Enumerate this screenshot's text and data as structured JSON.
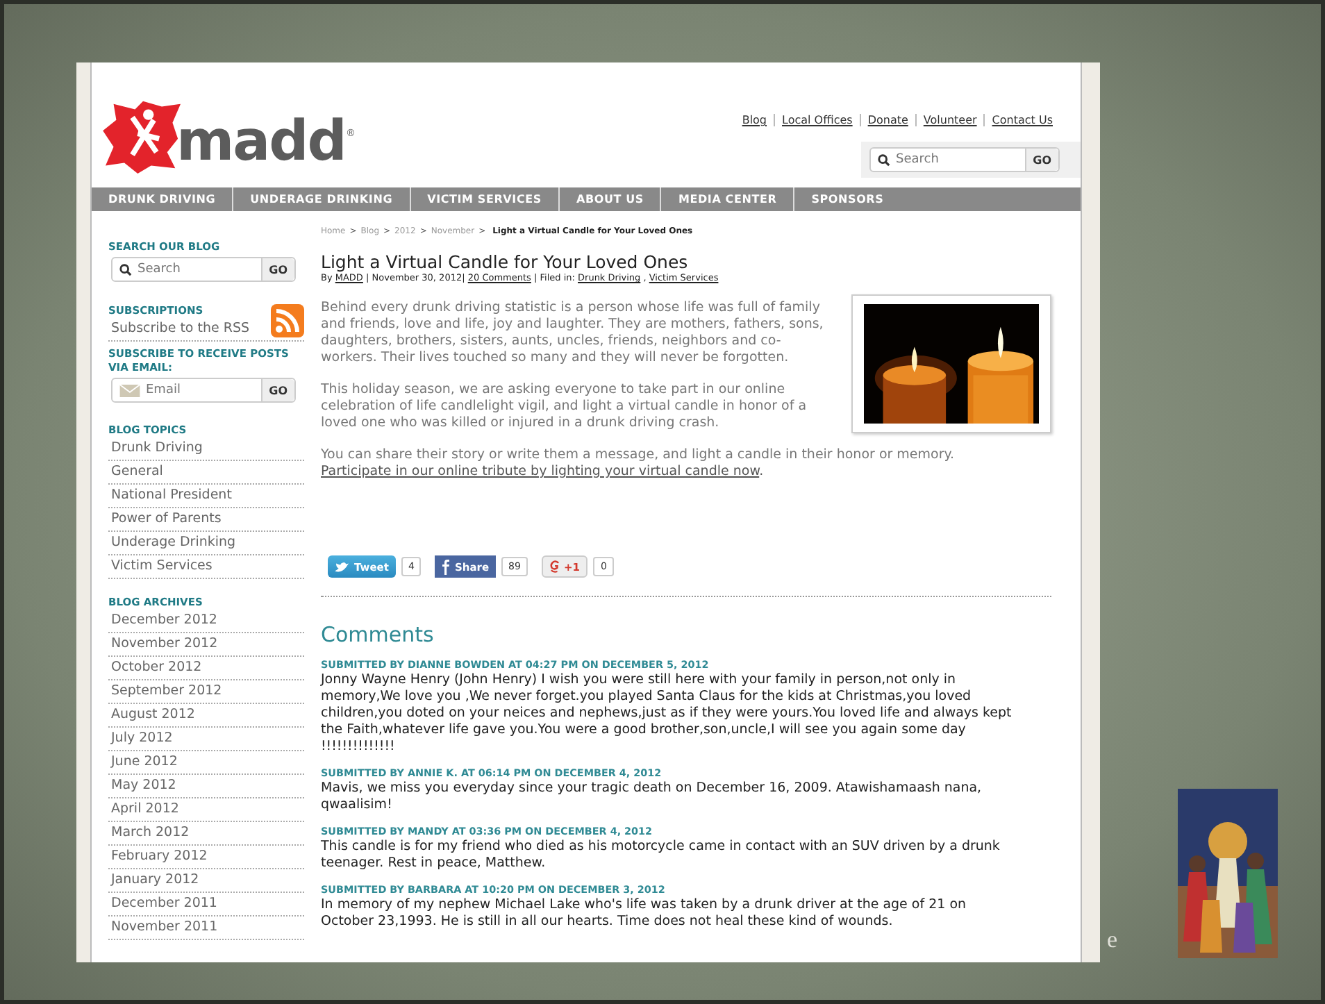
{
  "page": {
    "header": {
      "logo_text": "madd",
      "logo_mark": "®",
      "top_links": [
        "Blog",
        "Local Offices",
        "Donate",
        "Volunteer",
        "Contact Us"
      ],
      "search": {
        "placeholder": "Search",
        "button": "GO"
      }
    },
    "nav": [
      "DRUNK DRIVING",
      "UNDERAGE DRINKING",
      "VICTIM SERVICES",
      "ABOUT US",
      "MEDIA CENTER",
      "SPONSORS"
    ],
    "sidebar": {
      "search": {
        "heading": "SEARCH OUR BLOG",
        "placeholder": "Search",
        "button": "GO"
      },
      "subscriptions": {
        "heading": "SUBSCRIPTIONS",
        "link": "Subscribe to the RSS"
      },
      "email": {
        "heading": "SUBSCRIBE TO RECEIVE POSTS VIA EMAIL:",
        "placeholder": "Email",
        "button": "GO"
      },
      "topics": {
        "heading": "BLOG TOPICS",
        "items": [
          "Drunk Driving",
          "General",
          "National President",
          "Power of Parents",
          "Underage Drinking",
          "Victim Services"
        ]
      },
      "archives": {
        "heading": "BLOG ARCHIVES",
        "items": [
          "December 2012",
          "November 2012",
          "October 2012",
          "September 2012",
          "August 2012",
          "July 2012",
          "June 2012",
          "May 2012",
          "April 2012",
          "March 2012",
          "February 2012",
          "January 2012",
          "December 2011",
          "November 2011"
        ]
      }
    },
    "article": {
      "breadcrumb": [
        "Home",
        "Blog",
        "2012",
        "November",
        "Light a Virtual Candle for Your Loved Ones"
      ],
      "breadcrumb_separator": ">",
      "title": "Light a Virtual Candle for Your Loved Ones",
      "byline": {
        "prefix": "By",
        "author": "MADD",
        "date": "| November 30, 2012|",
        "comments_link": "20 Comments",
        "filed_label": "| Filed in:",
        "categories": [
          "Drunk Driving",
          "Victim Services"
        ],
        "category_separator": ","
      },
      "image": {
        "kind": "picture"
      },
      "paragraphs": [
        "Behind every drunk driving statistic is a person whose life was full of family and friends, love and life, joy and laughter.  They are mothers, fathers, sons, daughters, brothers, sisters, aunts, uncles, friends, neighbors and co-workers. Their lives touched so many and they will never be forgotten.",
        "This holiday season, we are asking everyone to take part in our online celebration of life candlelight vigil, and light a virtual candle in honor of a loved one who was killed or injured in a drunk driving crash.",
        "You can share their story or write them a message, and light a candle in their honor or memory."
      ],
      "tribute_link": "Participate in our online tribute by lighting your virtual candle now",
      "tribute_end": ".",
      "share": [
        {
          "kind": "twitter",
          "label": "Tweet",
          "count": "4"
        },
        {
          "kind": "facebook",
          "label": "Share",
          "count": "89"
        },
        {
          "kind": "google",
          "label": "+1",
          "count": "0"
        }
      ]
    },
    "comments": {
      "heading": "Comments",
      "items": [
        {
          "author": "SUBMITTED BY DIANNE BOWDEN AT 04:27 PM ON DECEMBER 5, 2012",
          "text": "Jonny Wayne Henry (John Henry) I wish you were still here with your family in person,not only in memory,We love you ,We never forget.you played Santa Claus for the kids at Christmas,you loved children,you doted on your neices and nephews,just as if they were yours.You loved life and always kept the Faith,whatever life gave you.You were a good brother,son,uncle,I will see you again some day !!!!!!!!!!!!!!"
        },
        {
          "author": "SUBMITTED BY ANNIE K. AT 06:14 PM ON DECEMBER 4, 2012",
          "text": "Mavis, we miss you everyday since your tragic death on December 16, 2009. Atawishamaash nana, qwaalisim!"
        },
        {
          "author": "SUBMITTED BY MANDY AT 03:36 PM ON DECEMBER 4, 2012",
          "text": "This candle is for my friend who died as his motorcycle came in contact with an SUV driven by a drunk teenager. Rest in peace, Matthew."
        },
        {
          "author": "SUBMITTED BY BARBARA AT 10:20 PM ON DECEMBER 3, 2012",
          "text": "In memory of my nephew Michael Lake who's life was taken by a drunk driver at the age of 21 on October 23,1993. He is still in all our hearts. Time does not heal these kind of wounds."
        }
      ]
    }
  },
  "slide": {
    "text_fragment": "e",
    "side_image": {
      "kind": "picture"
    }
  }
}
